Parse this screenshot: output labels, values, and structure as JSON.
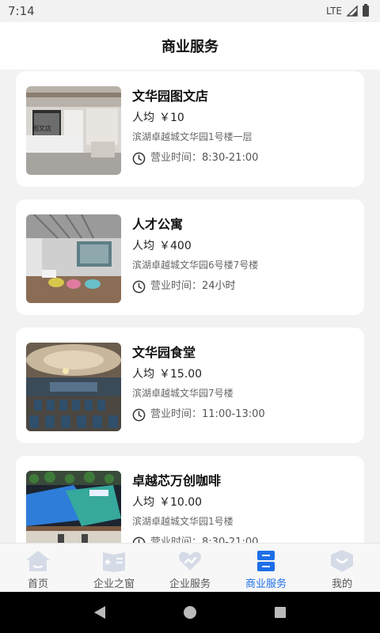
{
  "status_bar": {
    "time": "7:14",
    "network": "LTE"
  },
  "header": {
    "title": "商业服务"
  },
  "price_label": "人均",
  "hours_label": "营业时间：",
  "cards": [
    {
      "name": "文华园图文店",
      "price": "￥10",
      "address": "滨湖卓越城文华园1号楼一层",
      "hours": "8:30-21:00",
      "image": "print-shop-interior"
    },
    {
      "name": "人才公寓",
      "price": "￥400",
      "address": "滨湖卓越城文华园6号楼7号楼",
      "hours": "24小时",
      "image": "apartment-lobby"
    },
    {
      "name": "文华园食堂",
      "price": "￥15.00",
      "address": "滨湖卓越城文华园7号楼",
      "hours": "11:00-13:00",
      "image": "canteen-dining-hall"
    },
    {
      "name": "卓越芯万创咖啡",
      "price": "￥10.00",
      "address": "滨湖卓越城文华园1号楼",
      "hours": "8:30-21:00",
      "image": "coffee-bar"
    }
  ],
  "tabs": [
    {
      "label": "首页",
      "icon": "home-icon",
      "active": false
    },
    {
      "label": "企业之窗",
      "icon": "book-icon",
      "active": false
    },
    {
      "label": "企业服务",
      "icon": "heart-icon",
      "active": false
    },
    {
      "label": "商业服务",
      "icon": "store-icon",
      "active": true
    },
    {
      "label": "我的",
      "icon": "profile-shield-icon",
      "active": false
    }
  ],
  "colors": {
    "accent": "#1e6fe8",
    "tab_inactive_icon": "#d5dbe6"
  }
}
